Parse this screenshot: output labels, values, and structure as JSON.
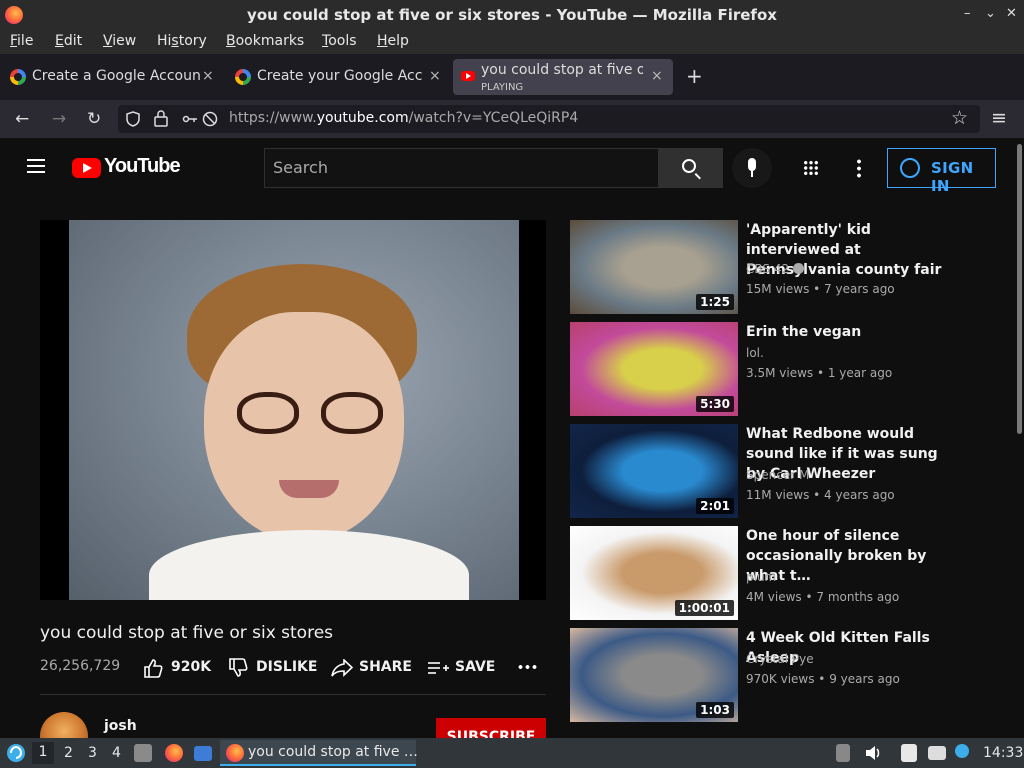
{
  "window": {
    "title": "you could stop at five or six stores - YouTube — Mozilla Firefox",
    "controls": [
      "–",
      "⌄",
      "✕"
    ]
  },
  "menubar": [
    {
      "label": "File",
      "key": "F",
      "rest": "ile"
    },
    {
      "label": "Edit",
      "key": "E",
      "rest": "dit"
    },
    {
      "label": "View",
      "key": "V",
      "rest": "iew"
    },
    {
      "label": "History",
      "pre": "Hi",
      "key": "s",
      "rest": "tory"
    },
    {
      "label": "Bookmarks",
      "key": "B",
      "rest": "ookmarks"
    },
    {
      "label": "Tools",
      "key": "T",
      "rest": "ools"
    },
    {
      "label": "Help",
      "key": "H",
      "rest": "elp"
    }
  ],
  "tabs": [
    {
      "title": "Create a Google Account",
      "close": "×"
    },
    {
      "title": "Create your Google Account",
      "close": "×"
    },
    {
      "title": "you could stop at five or six stores",
      "status": "PLAYING",
      "close": "×",
      "active": true
    }
  ],
  "new_tab": "+",
  "nav": {
    "url_prefix": "https://www.",
    "url_host": "youtube.com",
    "url_path": "/watch?v=YCeQLeQiRP4"
  },
  "youtube": {
    "logo_text": "YouTube",
    "search_placeholder": "Search",
    "signin_label": "SIGN IN"
  },
  "video": {
    "title": "you could stop at five or six stores",
    "views": "26,256,729",
    "likes": "920K",
    "dislike_label": "DISLIKE",
    "share_label": "SHARE",
    "save_label": "SAVE",
    "channel": "josh",
    "subscribe_label": "SUBSCRIBE"
  },
  "recommendations": [
    {
      "title": "'Apparently' kid interviewed at Pennsylvania county fair",
      "channel": "CBS 42",
      "verified": true,
      "views": "15M views",
      "age": "7 years ago",
      "duration": "1:25",
      "colors": [
        "#6a7a86",
        "#a8a090",
        "#5b4b3a"
      ]
    },
    {
      "title": "Erin the vegan",
      "channel": "lol.",
      "verified": false,
      "views": "3.5M views",
      "age": "1 year ago",
      "duration": "5:30",
      "colors": [
        "#c24a9a",
        "#d8cf4a",
        "#b8406e"
      ]
    },
    {
      "title": "What Redbone would sound like if it was sung by Carl Wheezer",
      "channel": "Spencer M",
      "verified": false,
      "views": "11M views",
      "age": "4 years ago",
      "duration": "2:01",
      "colors": [
        "#0e1e3c",
        "#2a8ad0",
        "#12264a"
      ]
    },
    {
      "title": "One hour of silence occasionally broken by what t…",
      "channel": "plum",
      "verified": false,
      "views": "4M views",
      "age": "7 months ago",
      "duration": "1:00:01",
      "colors": [
        "#f4f4f4",
        "#c99a6a",
        "#ffffff"
      ]
    },
    {
      "title": "4 Week Old Kitten Falls Asleep",
      "channel": "Crystal Pye",
      "verified": false,
      "views": "970K views",
      "age": "9 years ago",
      "duration": "1:03",
      "colors": [
        "#3c5a86",
        "#8a8a8a",
        "#d8b8a0"
      ]
    }
  ],
  "taskbar": {
    "workspaces": [
      "1",
      "2",
      "3",
      "4"
    ],
    "task_label": "you could stop at five …",
    "clock": "14:33"
  }
}
